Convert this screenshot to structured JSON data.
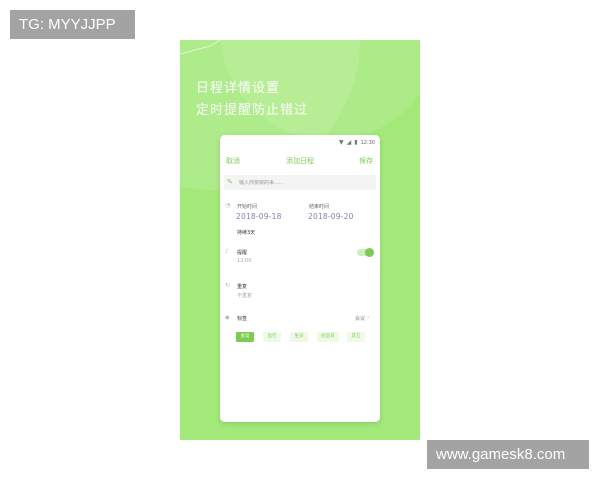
{
  "watermarks": {
    "top_left": "TG: MYYJJPP",
    "bottom_right": "www.gamesk8.com"
  },
  "promo": {
    "headline_1": "日程详情设置",
    "headline_2": "定时提醒防止错过",
    "background_color": "#a3e97a",
    "accent_color": "#7ccc54"
  },
  "status_bar": {
    "time": "12:30",
    "icons": [
      "wifi-icon",
      "signal-icon",
      "battery-icon"
    ]
  },
  "navbar": {
    "cancel": "取消",
    "title": "添加日程",
    "save": "保存"
  },
  "event_title": {
    "placeholder": "输入你要做的事……",
    "icon": "pencil-icon"
  },
  "time": {
    "start_label": "开始时间",
    "start_date": "2018-09-18",
    "end_label": "结束时间",
    "end_date": "2018-09-20",
    "duration": "持续3天",
    "icon": "clock-icon"
  },
  "reminder": {
    "label": "提醒",
    "value": "12:00",
    "enabled": true,
    "icon": "bell-icon"
  },
  "repeat": {
    "label": "重复",
    "value": "不重复",
    "icon": "repeat-icon"
  },
  "tags": {
    "label": "标签",
    "selected": "会议",
    "icon": "tag-icon",
    "options": [
      "会议",
      "出行",
      "生日",
      "纪念日",
      "其它"
    ]
  }
}
